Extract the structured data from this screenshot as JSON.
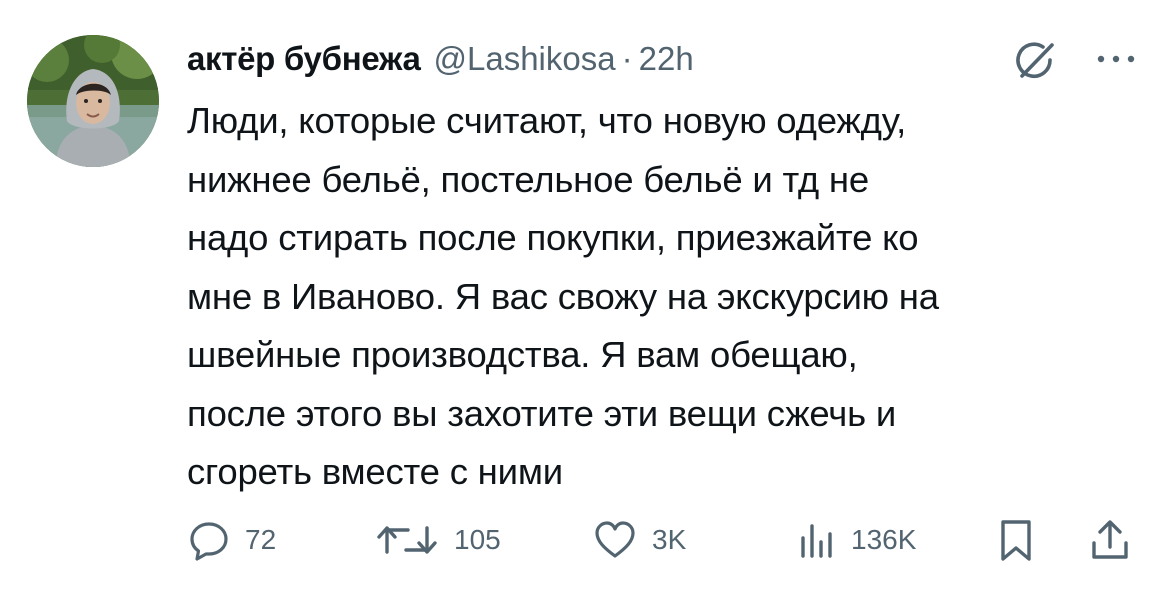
{
  "tweet": {
    "author": {
      "display_name": "актёр бубнежа",
      "handle": "@Lashikosa",
      "separator": "·",
      "time": "22h"
    },
    "text": "Люди, которые считают, что новую одежду,\nнижнее бельё, постельное бельё и тд не\nнадо стирать после покупки, приезжайте ко\nмне в Иваново. Я вас свожу на экскурсию на\nшвейные производства. Я вам обещаю,\nпосле этого вы захотите эти вещи сжечь и\nсгореть вместе с ними",
    "actions": {
      "replies": "72",
      "retweets": "105",
      "likes": "3K",
      "views": "136K"
    }
  },
  "icons": {
    "grok": "grok-slash-circle-icon",
    "more": "more-dots-icon",
    "reply": "reply-bubble-icon",
    "retweet": "retweet-arrows-icon",
    "like": "heart-icon",
    "views": "views-bars-icon",
    "bookmark": "bookmark-icon",
    "share": "share-upload-icon"
  },
  "colors": {
    "text_primary": "#0f1419",
    "text_secondary": "#536471"
  }
}
